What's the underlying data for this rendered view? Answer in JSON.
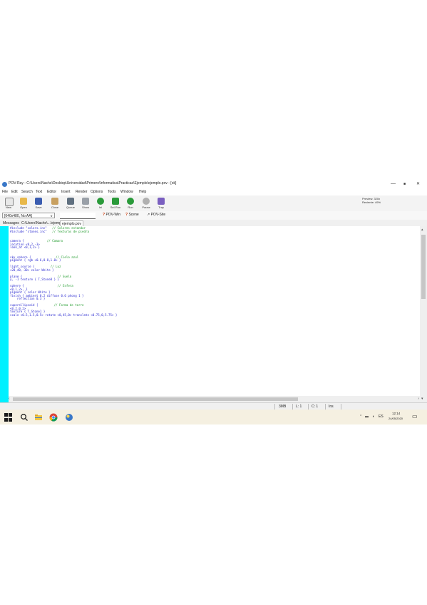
{
  "window": {
    "title": "POV-Ray - C:\\Users\\Nacho\\Desktop\\Universidad\\Primero\\Informatica\\Practicas\\Ejemplo\\ejemplo.pov - [ok]",
    "minimize": "—",
    "maximize": "■",
    "close": "✕"
  },
  "menu": [
    "File",
    "Edit",
    "Search",
    "Text",
    "Editor",
    "Insert",
    "Render",
    "Options",
    "Tools",
    "Window",
    "Help"
  ],
  "toolbar": {
    "buttons": [
      {
        "label": "New",
        "icon": "new-file-icon",
        "color": "#e8e8e8"
      },
      {
        "label": "Open",
        "icon": "open-folder-icon",
        "color": "#e8b84a"
      },
      {
        "label": "Save",
        "icon": "save-icon",
        "color": "#3b5db0"
      },
      {
        "label": "Close",
        "icon": "close-file-icon",
        "color": "#c8a060"
      },
      {
        "label": "Queue",
        "icon": "queue-icon",
        "color": "#607080"
      },
      {
        "label": "Show",
        "icon": "show-icon",
        "color": "#9aa0a8"
      },
      {
        "label": "Ini",
        "icon": "ini-icon",
        "color": "#2a9a3a"
      },
      {
        "label": "Sel-Run",
        "icon": "sel-run-icon",
        "color": "#2a9a3a"
      },
      {
        "label": "Run",
        "icon": "run-icon",
        "color": "#2a9a3a"
      },
      {
        "label": "Pause",
        "icon": "pause-icon",
        "color": "#b0b0b0"
      },
      {
        "label": "Tray",
        "icon": "tray-icon",
        "color": "#7a5fc0"
      }
    ],
    "panel_lines": [
      "Preview: 320x",
      "Reciente: 49%"
    ]
  },
  "toolbar2": {
    "resolution": "[640x480, No AA]",
    "help_items": [
      "POV-Win",
      "Scene",
      "POV-Site"
    ]
  },
  "tabs": [
    "Messages",
    "C:\\Users\\Nacho\\...\\ejemplo.pov",
    "ejemplo.pov"
  ],
  "code": [
    [
      {
        "t": "#include \"colors.inc\"   ",
        "c": "st"
      },
      {
        "t": "// Colores estandar",
        "c": "cm"
      }
    ],
    [
      {
        "t": "#include \"stones.inc\"   ",
        "c": "st"
      },
      {
        "t": "// Texturas de piedra",
        "c": "cm"
      }
    ],
    [],
    [],
    [
      {
        "t": "camera {             ",
        "c": "kw"
      },
      {
        "t": "// Camara",
        "c": "cm"
      }
    ],
    [
      {
        "t": "location <0,2,-3>",
        "c": "kw"
      }
    ],
    [
      {
        "t": "look_at <0,1,2> }",
        "c": "kw"
      }
    ],
    [],
    [],
    [
      {
        "t": "sky_sphere {              ",
        "c": "kw"
      },
      {
        "t": "// Cielo azul",
        "c": "cm"
      }
    ],
    [
      {
        "t": "pigment { rgb <0.6,0.8,1.0> }",
        "c": "kw"
      }
    ],
    [],
    [
      {
        "t": "light_source {         ",
        "c": "kw"
      },
      {
        "t": "// Luz",
        "c": "cm"
      }
    ],
    [
      {
        "t": "<20,40,-30> color White }",
        "c": "kw"
      }
    ],
    [],
    [
      {
        "t": "plane {                    ",
        "c": "kw"
      },
      {
        "t": "// Suelo",
        "c": "cm"
      }
    ],
    [
      {
        "t": "y, -1 texture { T_Stone8 } }",
        "c": "kw"
      }
    ],
    [],
    [
      {
        "t": "sphere {                   ",
        "c": "kw"
      },
      {
        "t": "// Esfera",
        "c": "cm"
      }
    ],
    [
      {
        "t": "<0,1,2>, 1",
        "c": "kw"
      }
    ],
    [
      {
        "t": "pigment { color White }",
        "c": "kw"
      }
    ],
    [
      {
        "t": "finish { ambient 0.2 diffuse 0.6 phong 1 }",
        "c": "kw"
      }
    ],
    [
      {
        "t": "    reflection 0.3 }",
        "c": "kw"
      }
    ],
    [],
    [
      {
        "t": "superellipsoid {         ",
        "c": "kw"
      },
      {
        "t": "// Forma de torre",
        "c": "cm"
      }
    ],
    [
      {
        "t": "<0.2,0.2>",
        "c": "kw"
      }
    ],
    [
      {
        "t": "texture { T_Stone1 }",
        "c": "kw"
      }
    ],
    [
      {
        "t": "scale <0.5,1.5,0.5> rotate <0,45,0> translate <0.75,0,5.75> }",
        "c": "kw"
      }
    ]
  ],
  "statusbar": {
    "mem": "3MB",
    "line": "L: 1",
    "col": "C: 1",
    "mode": "Ins"
  },
  "taskbar": {
    "clock_time": "12:14",
    "clock_date": "24/05/2020",
    "tray_label": "ES"
  },
  "colors": {
    "gutter": "#00f0ff",
    "keyword": "#2b2bd0",
    "comment": "#1f9a2b",
    "taskbar": "#f5f0e1"
  }
}
